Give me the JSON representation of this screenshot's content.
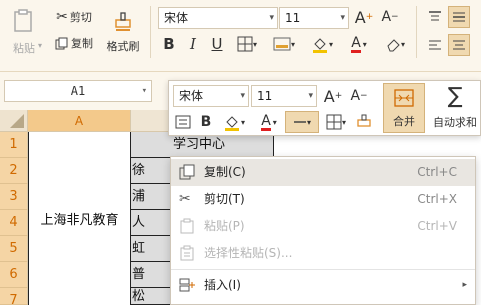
{
  "ribbon": {
    "paste": "粘贴",
    "cut": "剪切",
    "copy": "复制",
    "format_painter": "格式刷",
    "font_name": "宋体",
    "font_size": "11"
  },
  "formula_bar": {
    "cell_ref": "A1"
  },
  "columns": [
    "A"
  ],
  "rows": [
    "1",
    "2",
    "3",
    "4",
    "5",
    "6",
    "7"
  ],
  "cells": {
    "merged_a": "上海非凡教育",
    "b1": "学习中心",
    "b_col": [
      "徐",
      "浦",
      "人",
      "虹",
      "普",
      "松"
    ]
  },
  "mini_toolbar": {
    "font_name": "宋体",
    "font_size": "11",
    "merge_label": "合并",
    "autosum_label": "自动求和"
  },
  "context_menu": {
    "items": [
      {
        "label": "复制(C)",
        "shortcut": "Ctrl+C"
      },
      {
        "label": "剪切(T)",
        "shortcut": "Ctrl+X"
      },
      {
        "label": "粘贴(P)",
        "shortcut": "Ctrl+V"
      },
      {
        "label": "选择性粘贴(S)...",
        "shortcut": ""
      },
      {
        "label": "插入(I)",
        "shortcut": ""
      }
    ]
  },
  "colors": {
    "accent": "#d06a00",
    "selected_header": "#f5d5a5",
    "menu_highlight": "#e9e6e1"
  }
}
